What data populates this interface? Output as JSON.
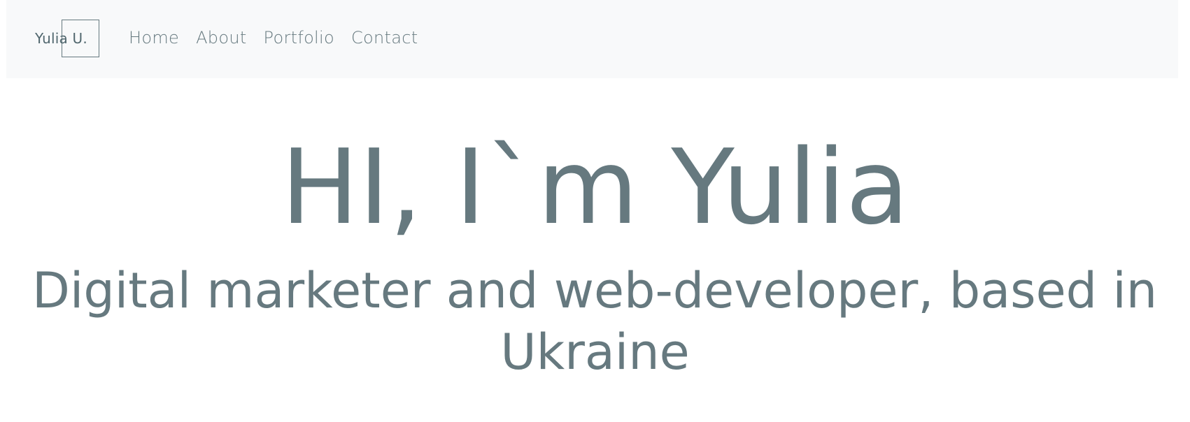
{
  "nav": {
    "logo": "Yulia U.",
    "links": [
      {
        "label": "Home"
      },
      {
        "label": "About"
      },
      {
        "label": "Portfolio"
      },
      {
        "label": "Contact"
      }
    ]
  },
  "hero": {
    "title": "HI, I`m Yulia",
    "subtitle_line1": "Digital marketer and web-developer, based in",
    "subtitle_line2": "Ukraine"
  },
  "colors": {
    "text": "#66797f",
    "navbar_bg": "#f8f9fa",
    "page_bg": "#ffffff"
  }
}
